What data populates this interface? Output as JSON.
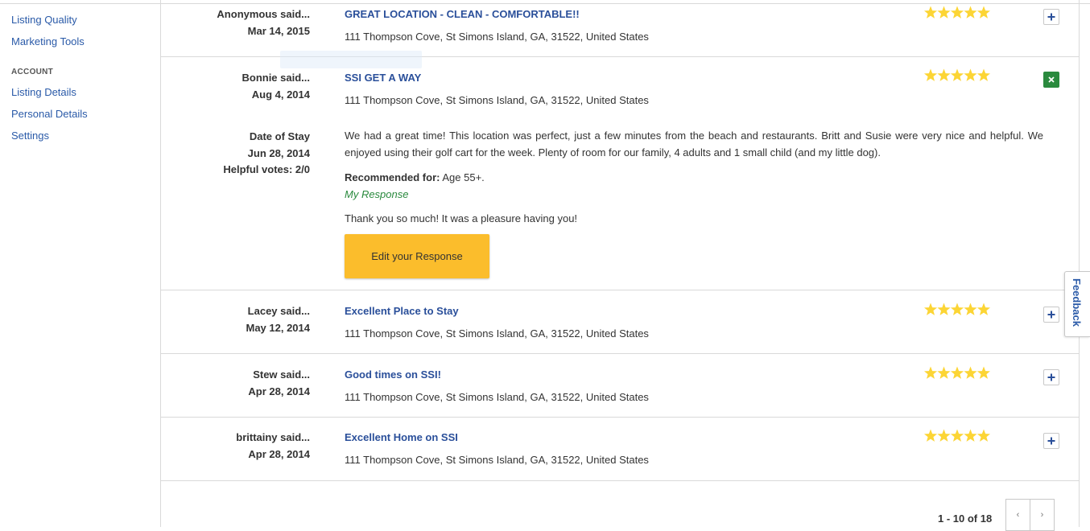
{
  "sidebar": {
    "items_top": [
      {
        "label": "Listing Quality"
      },
      {
        "label": "Marketing Tools"
      }
    ],
    "account_heading": "ACCOUNT",
    "items_account": [
      {
        "label": "Listing Details"
      },
      {
        "label": "Personal Details"
      },
      {
        "label": "Settings"
      }
    ]
  },
  "reviews": [
    {
      "author": "Anonymous said...",
      "date": "Mar 14, 2015",
      "title": "GREAT LOCATION - CLEAN - COMFORTABLE!!",
      "address": "111 Thompson Cove, St Simons Island, GA, 31522, United States",
      "rating": 5,
      "toggle": "+"
    },
    {
      "author": "Bonnie said...",
      "date": "Aug 4, 2014",
      "title": "SSI GET A WAY",
      "address": "111 Thompson Cove, St Simons Island, GA, 31522, United States",
      "rating": 5,
      "toggle": "×",
      "stay_label": "Date of Stay",
      "stay_date": "Jun 28, 2014",
      "helpful_votes": "Helpful votes: 2/0",
      "text": "We had a great time! This location was perfect, just a few minutes from the beach and restaurants. Britt and Susie were very nice and helpful. We enjoyed using their golf cart for the week. Plenty of room for our family, 4 adults and 1 small child (and my little dog).",
      "recommended_label": "Recommended for:",
      "recommended_value": " Age 55+.",
      "my_response_label": "My Response",
      "response_text": "Thank you so much! It was a pleasure having you!",
      "edit_button": "Edit your Response"
    },
    {
      "author": "Lacey said...",
      "date": "May 12, 2014",
      "title": "Excellent Place to Stay",
      "address": "111 Thompson Cove, St Simons Island, GA, 31522, United States",
      "rating": 5,
      "toggle": "+"
    },
    {
      "author": "Stew said...",
      "date": "Apr 28, 2014",
      "title": "Good times on SSI!",
      "address": "111 Thompson Cove, St Simons Island, GA, 31522, United States",
      "rating": 5,
      "toggle": "+"
    },
    {
      "author": "brittainy said...",
      "date": "Apr 28, 2014",
      "title": "Excellent Home on SSI",
      "address": "111 Thompson Cove, St Simons Island, GA, 31522, United States",
      "rating": 5,
      "toggle": "+"
    }
  ],
  "pagination": {
    "summary": "1 - 10 of 18",
    "prev": "‹",
    "next": "›"
  },
  "feedback_tab": "Feedback",
  "colors": {
    "link": "#2a5aa8",
    "title": "#2a4f9a",
    "star": "#fcd535",
    "button": "#fbbd2c",
    "response": "#2a8a3e"
  },
  "icons": {
    "star": "star-icon",
    "expand": "plus-icon",
    "collapse": "close-icon"
  }
}
